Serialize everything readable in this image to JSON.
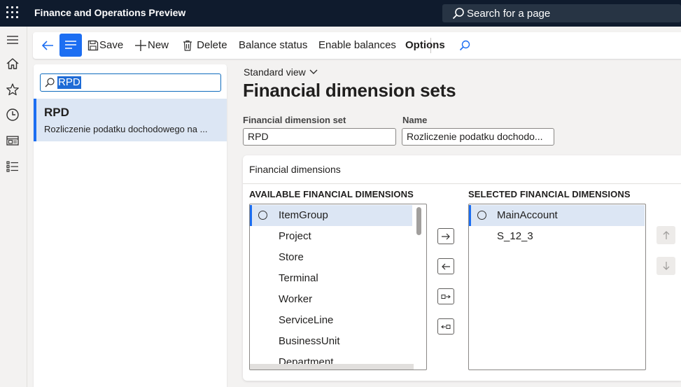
{
  "app": {
    "title": "Finance and Operations Preview"
  },
  "search": {
    "placeholder": "Search for a page"
  },
  "leftnav": {
    "items": [
      {
        "icon": "hamburger-icon"
      },
      {
        "icon": "home-icon"
      },
      {
        "icon": "star-icon"
      },
      {
        "icon": "clock-icon"
      },
      {
        "icon": "workspace-icon"
      },
      {
        "icon": "modules-list-icon"
      }
    ]
  },
  "toolbar": {
    "save": "Save",
    "new": "New",
    "delete": "Delete",
    "balance_status": "Balance status",
    "enable_balances": "Enable balances",
    "options": "Options"
  },
  "list": {
    "filter_value": "RPD",
    "items": [
      {
        "code": "RPD",
        "description": "Rozliczenie podatku dochodowego na ..."
      }
    ]
  },
  "page": {
    "view": "Standard view",
    "title": "Financial dimension sets"
  },
  "fields": {
    "set_label": "Financial dimension set",
    "set_value": "RPD",
    "name_label": "Name",
    "name_value": "Rozliczenie podatku dochodo..."
  },
  "dimensions": {
    "section_title": "Financial dimensions",
    "available_header": "AVAILABLE FINANCIAL DIMENSIONS",
    "selected_header": "SELECTED FINANCIAL DIMENSIONS",
    "available": [
      "ItemGroup",
      "Project",
      "Store",
      "Terminal",
      "Worker",
      "ServiceLine",
      "BusinessUnit",
      "Department"
    ],
    "selected": [
      "MainAccount",
      "S_12_3"
    ]
  },
  "colors": {
    "accent": "#1c6ef2",
    "topbar": "#0f1b2d",
    "selected_row": "#dce6f4"
  }
}
